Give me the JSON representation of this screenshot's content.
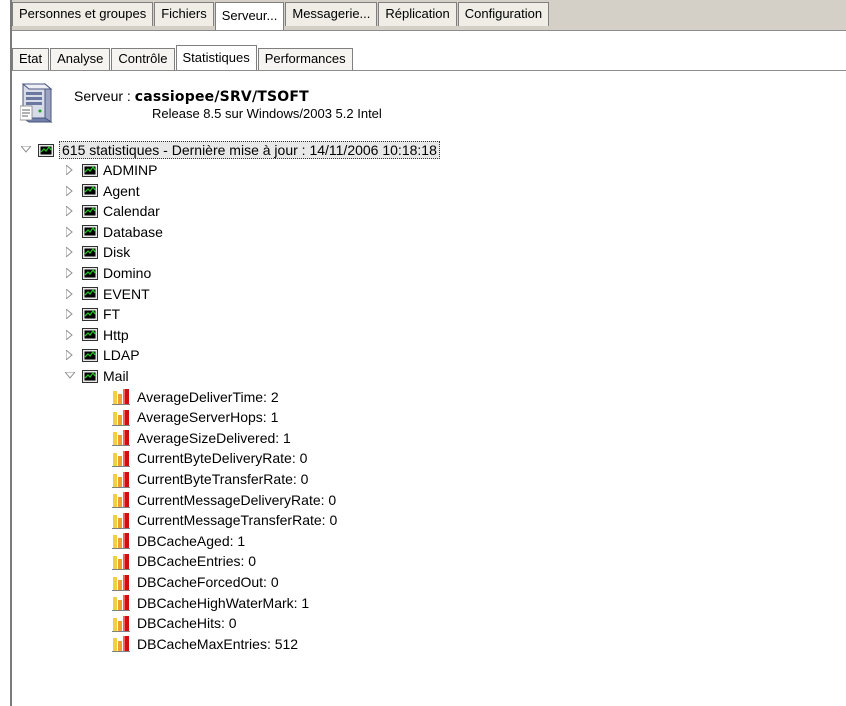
{
  "top_tabs": [
    {
      "label": "Personnes et groupes",
      "active": false
    },
    {
      "label": "Fichiers",
      "active": false
    },
    {
      "label": "Serveur...",
      "active": true
    },
    {
      "label": "Messagerie...",
      "active": false
    },
    {
      "label": "Réplication",
      "active": false
    },
    {
      "label": "Configuration",
      "active": false
    }
  ],
  "sub_tabs": [
    {
      "label": "Etat",
      "active": false
    },
    {
      "label": "Analyse",
      "active": false
    },
    {
      "label": "Contrôle",
      "active": false
    },
    {
      "label": "Statistiques",
      "active": true
    },
    {
      "label": "Performances",
      "active": false
    }
  ],
  "server": {
    "prefix": "Serveur :",
    "name": "cassiopee/SRV/TSOFT",
    "release": "Release 8.5 sur Windows/2003 5.2 Intel",
    "icon": "server-icon"
  },
  "tree": {
    "root_label": "615 statistiques - Dernière mise à jour : 14/11/2006 10:18:18",
    "categories": [
      {
        "label": "ADMINP",
        "expanded": false
      },
      {
        "label": "Agent",
        "expanded": false
      },
      {
        "label": "Calendar",
        "expanded": false
      },
      {
        "label": "Database",
        "expanded": false
      },
      {
        "label": "Disk",
        "expanded": false
      },
      {
        "label": "Domino",
        "expanded": false
      },
      {
        "label": "EVENT",
        "expanded": false
      },
      {
        "label": "FT",
        "expanded": false
      },
      {
        "label": "Http",
        "expanded": false
      },
      {
        "label": "LDAP",
        "expanded": false
      },
      {
        "label": "Mail",
        "expanded": true
      }
    ],
    "mail_stats": [
      "AverageDeliverTime: 2",
      "AverageServerHops: 1",
      "AverageSizeDelivered: 1",
      "CurrentByteDeliveryRate: 0",
      "CurrentByteTransferRate: 0",
      "CurrentMessageDeliveryRate: 0",
      "CurrentMessageTransferRate: 0",
      "DBCacheAged: 1",
      "DBCacheEntries: 0",
      "DBCacheForcedOut: 0",
      "DBCacheHighWaterMark: 1",
      "DBCacheHits: 0",
      "DBCacheMaxEntries: 512"
    ]
  },
  "colors": {
    "stat_icon_green": "#20c020",
    "bar_red": "#d01010",
    "bar_orange": "#f0a030",
    "bar_yellow": "#f0d040"
  }
}
